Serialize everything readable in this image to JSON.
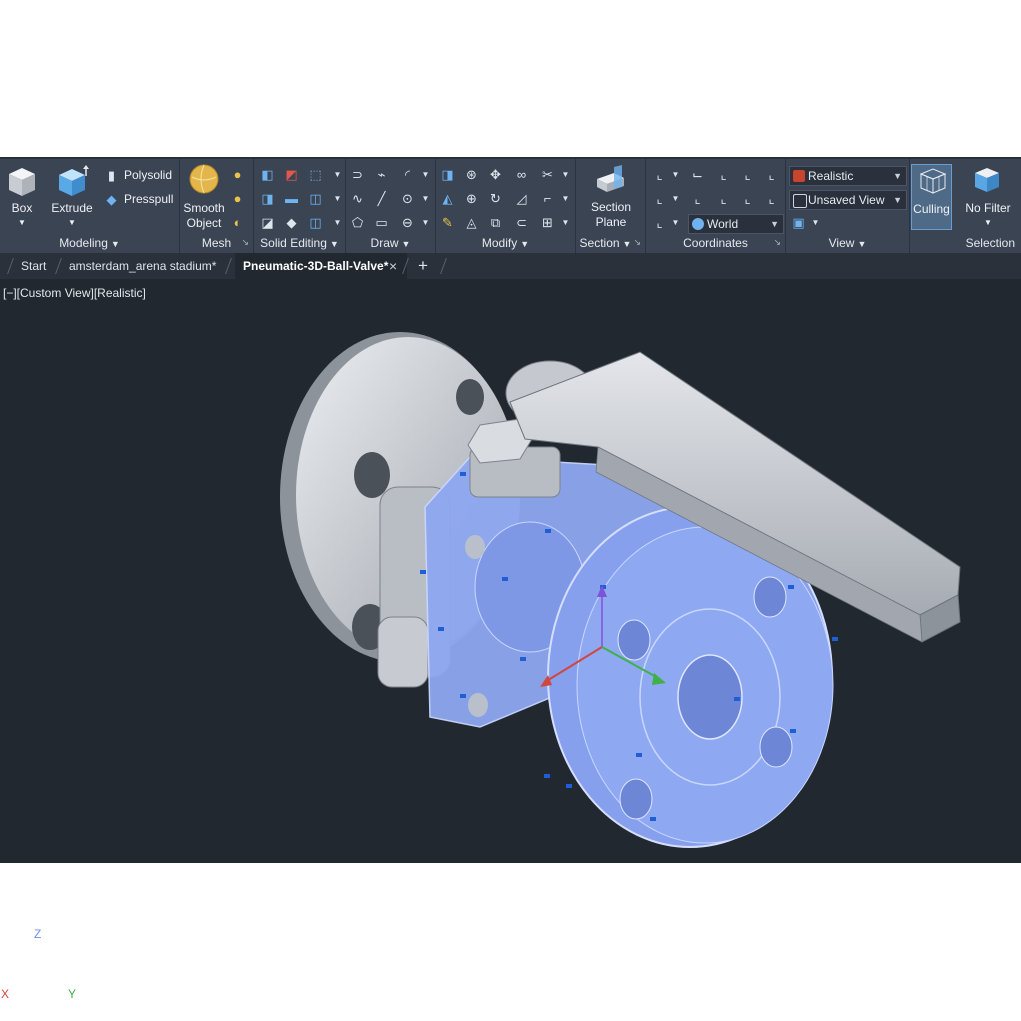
{
  "ribbon": {
    "modeling": {
      "title": "Modeling",
      "box": "Box",
      "extrude": "Extrude",
      "polysolid": "Polysolid",
      "presspull": "Presspull"
    },
    "mesh": {
      "title": "Mesh",
      "smooth_line1": "Smooth",
      "smooth_line2": "Object"
    },
    "solid_editing": {
      "title": "Solid Editing"
    },
    "draw": {
      "title": "Draw"
    },
    "modify": {
      "title": "Modify"
    },
    "section": {
      "title": "Section",
      "plane_line1": "Section",
      "plane_line2": "Plane"
    },
    "coordinates": {
      "title": "Coordinates",
      "ucs_combo": "World"
    },
    "view": {
      "title": "View",
      "visual_style": "Realistic",
      "named_view": "Unsaved View"
    },
    "selection": {
      "title": "Selection",
      "culling": "Culling",
      "filter": "No Filter"
    }
  },
  "tabs": {
    "start": "Start",
    "tab1": "amsterdam_arena stadium*",
    "tab2": "Pneumatic-3D-Ball-Valve*",
    "close": "×",
    "add": "+"
  },
  "viewport": {
    "label": "[−][Custom View][Realistic]",
    "axis_z": "Z",
    "axis_y": "Y",
    "axis_x": "X"
  },
  "colors": {
    "ribbon_bg": "#3b4453",
    "viewport_bg": "#212830",
    "selection_blue": "#8ea7f0",
    "accent_blue": "#6fb3f0"
  }
}
